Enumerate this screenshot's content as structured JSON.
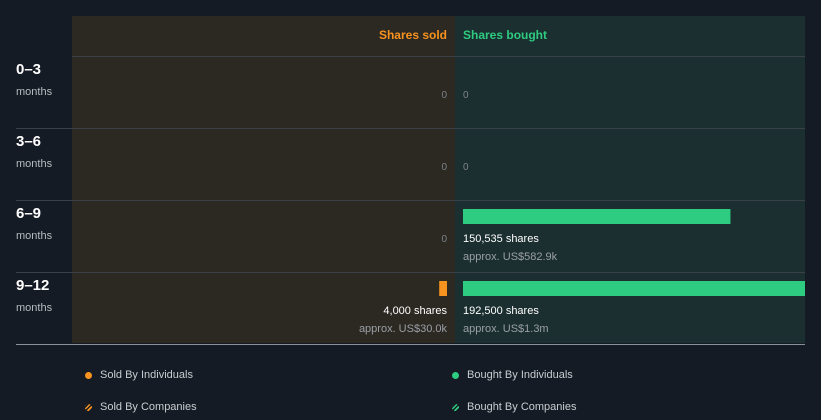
{
  "chart_data": {
    "type": "bar",
    "header": {
      "sold": "Shares sold",
      "bought": "Shares bought"
    },
    "rows": [
      {
        "period": "0–3",
        "unit": "months",
        "sold_shares": 0,
        "sold_label": "0",
        "sold_value": "",
        "bought_shares": 0,
        "bought_label": "0",
        "bought_value": ""
      },
      {
        "period": "3–6",
        "unit": "months",
        "sold_shares": 0,
        "sold_label": "0",
        "sold_value": "",
        "bought_shares": 0,
        "bought_label": "0",
        "bought_value": ""
      },
      {
        "period": "6–9",
        "unit": "months",
        "sold_shares": 0,
        "sold_label": "0",
        "sold_value": "",
        "bought_shares": 150535,
        "bought_label": "150,535 shares",
        "bought_value": "approx. US$582.9k"
      },
      {
        "period": "9–12",
        "unit": "months",
        "sold_shares": 4000,
        "sold_label": "4,000 shares",
        "sold_value": "approx. US$30.0k",
        "bought_shares": 192500,
        "bought_label": "192,500 shares",
        "bought_value": "approx. US$1.3m"
      }
    ],
    "max_shares": 192500,
    "colors": {
      "sold": "#f7931e",
      "bought": "#2ecc80",
      "sold_bg": "#2c2822",
      "bought_bg": "#1b2e30"
    },
    "legend": [
      {
        "label": "Sold By Individuals",
        "color": "#f7931e",
        "style": "dot"
      },
      {
        "label": "Bought By Individuals",
        "color": "#2ecc80",
        "style": "dot"
      },
      {
        "label": "Sold By Companies",
        "color": "#f7931e",
        "style": "hatch"
      },
      {
        "label": "Bought By Companies",
        "color": "#2ecc80",
        "style": "hatch"
      }
    ]
  }
}
